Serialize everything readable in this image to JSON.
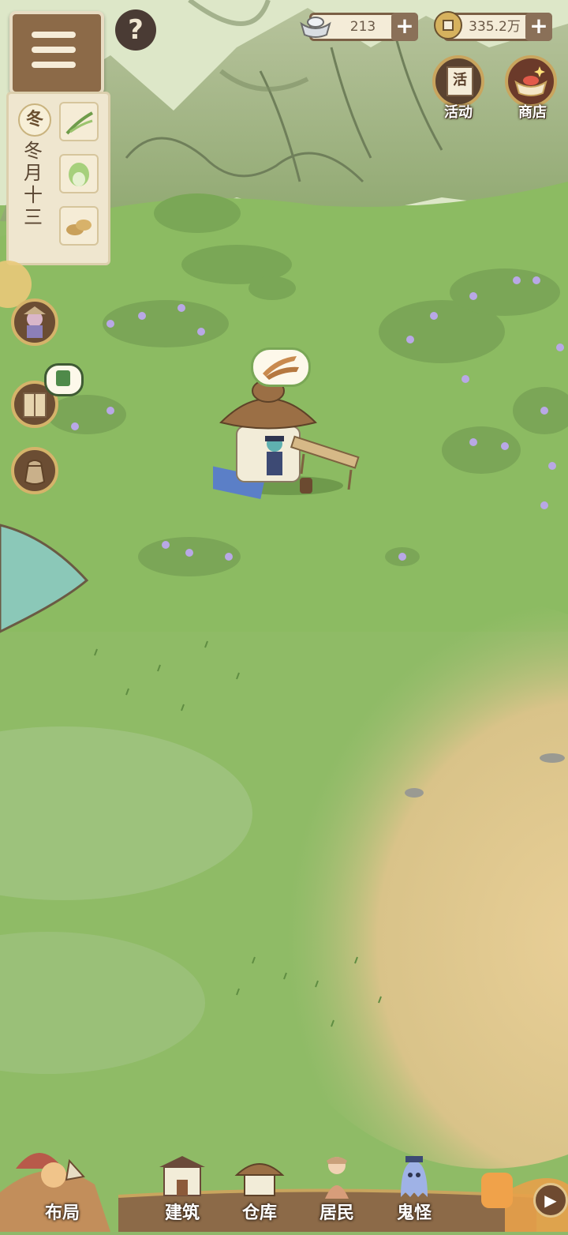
{
  "resources": {
    "silver": {
      "value": "213",
      "icon": "silver-ingot-icon"
    },
    "coins": {
      "value": "335.2万",
      "icon": "copper-coin-icon"
    }
  },
  "top_right": {
    "activity_label": "活动",
    "activity_icon_char": "活",
    "shop_label": "商店"
  },
  "help": {
    "label": "?"
  },
  "calendar": {
    "season": "冬",
    "date": [
      "冬",
      "月",
      "十",
      "三"
    ],
    "crops": [
      "scallion-icon",
      "cabbage-icon",
      "potato-icon"
    ]
  },
  "speech_bubble": {
    "icon": "dried-fish-icon"
  },
  "side_buttons": [
    "villager-portrait-icon",
    "book-icon",
    "sack-icon"
  ],
  "bottom_nav": [
    {
      "id": "layout",
      "label": "布局"
    },
    {
      "id": "build",
      "label": "建筑"
    },
    {
      "id": "storage",
      "label": "仓库"
    },
    {
      "id": "residents",
      "label": "居民"
    },
    {
      "id": "ghosts",
      "label": "鬼怪"
    }
  ],
  "colors": {
    "grass": "#8fb86a",
    "sand": "#e6c98e",
    "wood": "#8c6a48",
    "panel": "#efe6cf"
  }
}
